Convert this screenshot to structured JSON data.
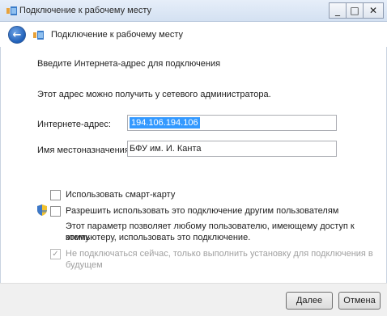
{
  "window": {
    "title": "Подключение к рабочему месту",
    "minimize": "_",
    "maximize": "□",
    "close": "✕"
  },
  "nav": {
    "back_glyph": "←",
    "title": "Подключение к рабочему месту"
  },
  "main": {
    "heading": "Введите Интернета-адрес для подключения",
    "subtext": "Этот адрес можно получить у сетевого администратора.",
    "address_label": "Интернете-адрес:",
    "address_value": "194.106.194.106",
    "destination_label": "Имя местоназначения:",
    "destination_value": "БФУ им. И. Канта",
    "smartcard_label": "Использовать смарт-карту",
    "allow_others_label": "Разрешить использовать это подключение другим пользователям",
    "allow_others_desc_1": "Этот параметр позволяет любому пользователю, имеющему доступ к этому",
    "allow_others_desc_2": "компьютеру, использовать это подключение.",
    "dont_connect_label_1": "Не подключаться сейчас, только выполнить установку для подключения в",
    "dont_connect_label_2": "будущем",
    "dont_connect_mark": "✓"
  },
  "footer": {
    "next_label": "Далее",
    "cancel_label": "Отмена"
  },
  "colors": {
    "titlebar": "#d4e1f2",
    "selection": "#3399ff",
    "disabled_text": "#a0a0a0",
    "footer_bg": "#f0f0f0"
  },
  "icons": {
    "title": "network-connection-icon",
    "back": "back-arrow-icon",
    "shield": "uac-shield-icon"
  }
}
